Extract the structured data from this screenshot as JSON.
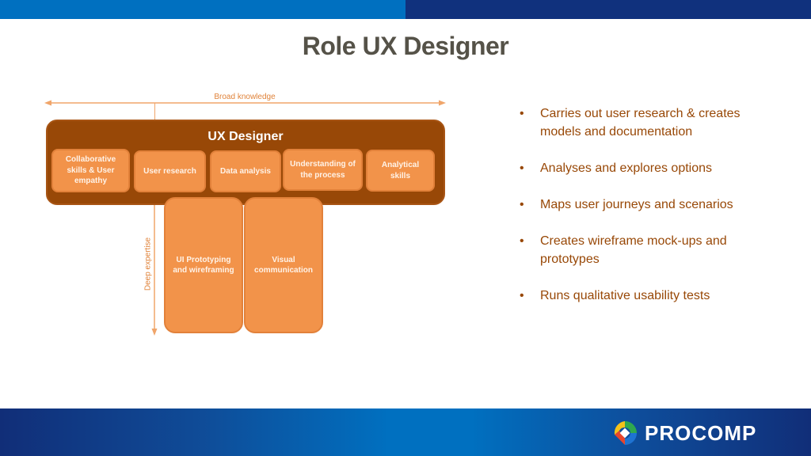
{
  "slide": {
    "title": "Role UX Designer",
    "colors": {
      "top_bar_left": "#0070c0",
      "top_bar_right": "#10317d",
      "title": "#555248",
      "main_box": "#984807",
      "skill_box": "#f2934a",
      "accent_text": "#984807",
      "axis": "#e0833a"
    }
  },
  "diagram": {
    "broad_axis_label": "Broad knowledge",
    "deep_axis_label": "Deep expertise",
    "main_box_title": "UX Designer",
    "broad_skills": [
      "Collaborative skills & User empathy",
      "User research",
      "Data analysis",
      "Understanding of the process",
      "Analytical skills"
    ],
    "deep_skills": [
      "UI Prototyping and wireframing",
      "Visual communication"
    ]
  },
  "bullets": [
    "Carries out user research & creates models and documentation",
    "Analyses and explores options",
    "Maps user journeys and scenarios",
    "Creates wireframe mock-ups and prototypes",
    "Runs qualitative usability tests"
  ],
  "footer": {
    "logo_icon": "procomp-logo-icon",
    "brand": "PROCOMP"
  }
}
